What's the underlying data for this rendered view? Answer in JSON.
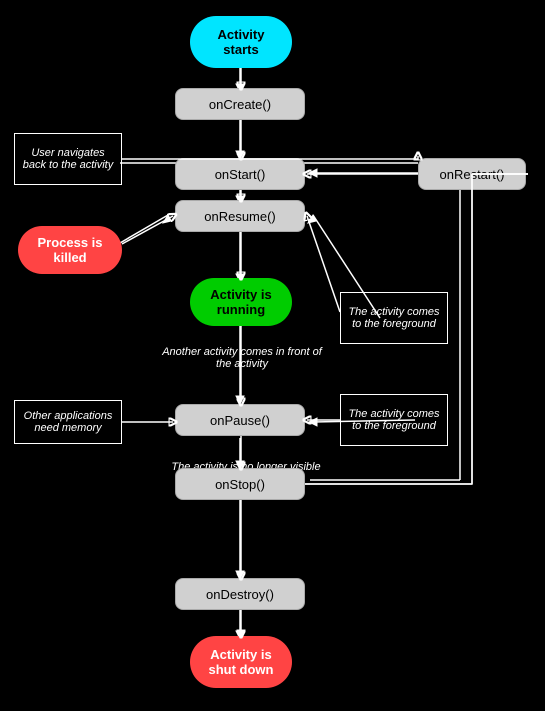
{
  "nodes": {
    "activity_starts": "Activity starts",
    "on_create": "onCreate()",
    "on_start": "onStart()",
    "on_restart": "onRestart()",
    "on_resume": "onResume()",
    "activity_running": "Activity is running",
    "on_pause": "onPause()",
    "on_stop": "onStop()",
    "on_destroy": "onDestroy()",
    "activity_shutdown": "Activity is shut down",
    "process_killed": "Process is killed",
    "user_navigates": "User navigates back to the activity",
    "another_activity": "Another activity comes in front of the activity",
    "other_apps": "Other applications need memory",
    "no_longer_visible": "The activity is no longer visible",
    "comes_foreground_1": "The activity comes to the foreground",
    "comes_foreground_2": "The activity comes to the foreground"
  }
}
